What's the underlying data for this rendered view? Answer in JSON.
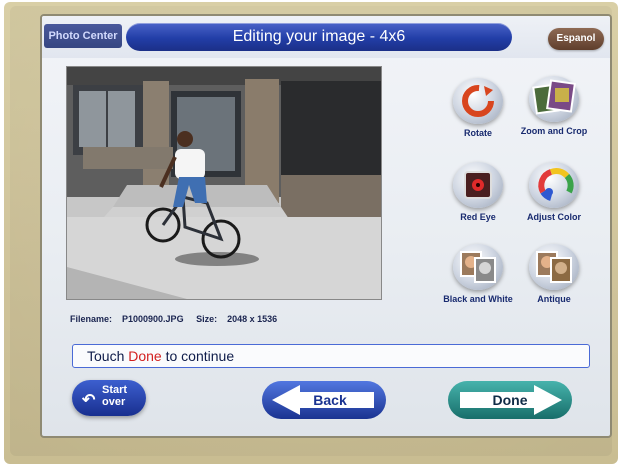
{
  "header": {
    "brand": "Photo Center",
    "title": "Editing your image - 4x6",
    "language_button": "Espanol"
  },
  "tools": [
    {
      "name": "rotate",
      "label": "Rotate",
      "icon": "rotate-icon"
    },
    {
      "name": "zoom-crop",
      "label": "Zoom and Crop",
      "icon": "zoom-crop-icon"
    },
    {
      "name": "red-eye",
      "label": "Red Eye",
      "icon": "red-eye-icon"
    },
    {
      "name": "adjust-color",
      "label": "Adjust Color",
      "icon": "color-wheel-icon"
    },
    {
      "name": "black-white",
      "label": "Black and White",
      "icon": "black-white-icon"
    },
    {
      "name": "antique",
      "label": "Antique",
      "icon": "antique-icon"
    }
  ],
  "file": {
    "filename_label": "Filename:",
    "filename": "P1000900.JPG",
    "size_label": "Size:",
    "size": "2048 x 1536"
  },
  "message": {
    "prefix": "Touch ",
    "highlight": "Done",
    "suffix": " to continue"
  },
  "buttons": {
    "start_over_line1": "Start",
    "start_over_line2": "over",
    "back": "Back",
    "done": "Done"
  },
  "colors": {
    "title_bar": "#223ea7",
    "highlight": "#d21f1f",
    "done_button": "#1f8a86",
    "back_button": "#2443b3"
  }
}
